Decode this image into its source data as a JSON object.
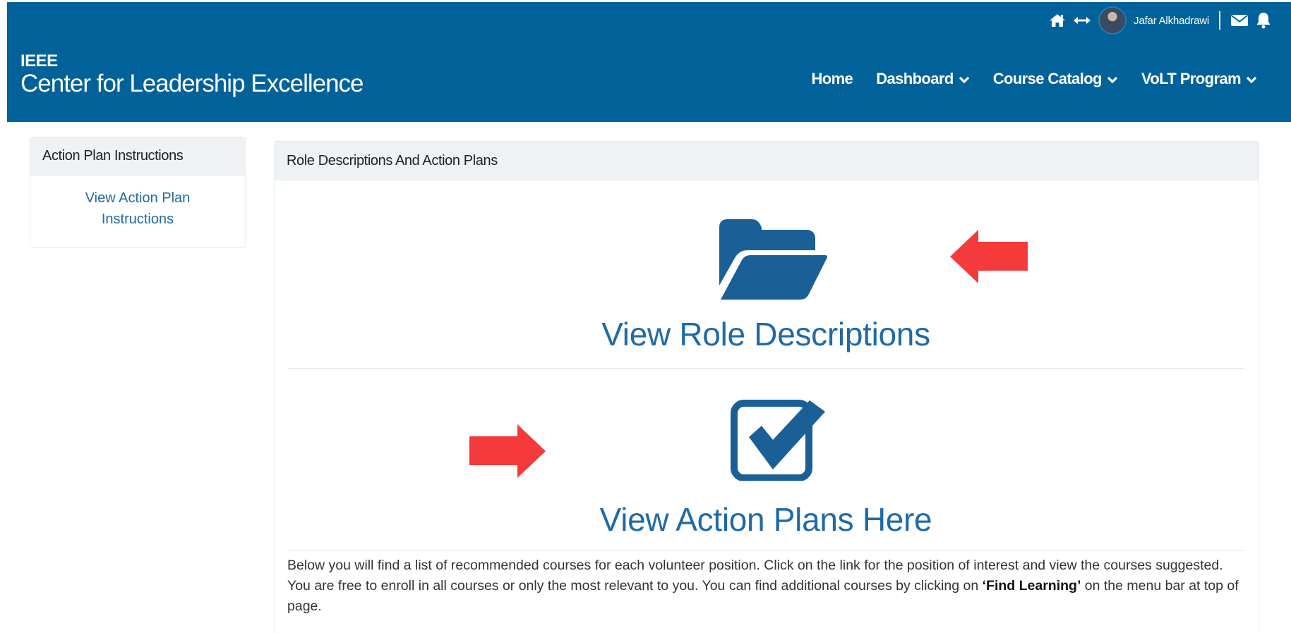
{
  "header": {
    "org": "IEEE",
    "title": "Center for Leadership Excellence",
    "user_name": "Jafar Alkhadrawi",
    "icons": [
      "home-icon",
      "expand-arrows-icon",
      "avatar",
      "mail-icon",
      "bell-icon"
    ],
    "nav": [
      {
        "label": "Home",
        "has_dropdown": false
      },
      {
        "label": "Dashboard",
        "has_dropdown": true
      },
      {
        "label": "Course Catalog",
        "has_dropdown": true
      },
      {
        "label": "VoLT Program",
        "has_dropdown": true
      }
    ]
  },
  "sidebar": {
    "heading": "Action Plan Instructions",
    "link": "View Action Plan Instructions"
  },
  "main": {
    "heading": "Role Descriptions And Action Plans",
    "role_link": "View Role Descriptions",
    "role_icon": "folder-open-icon",
    "plans_link": "View Action Plans Here",
    "plans_icon": "check-square-icon",
    "description": {
      "text_1": "Below you will find a list of recommended courses for each volunteer position. Click on the link for the position of interest and view the courses suggested. You are free to enroll in all courses or only the most relevant to you. You can find additional courses by clicking on ",
      "emphasis": "‘Find Learning’",
      "text_2": " on the menu bar at top of page."
    }
  },
  "annotations": {
    "arrow_color": "#f43a3a",
    "arrows": [
      "left-arrow",
      "right-arrow"
    ]
  },
  "colors": {
    "brand_blue": "#01629a",
    "link_blue": "#1f6aa5",
    "panel_heading_bg": "#eef2f5"
  }
}
